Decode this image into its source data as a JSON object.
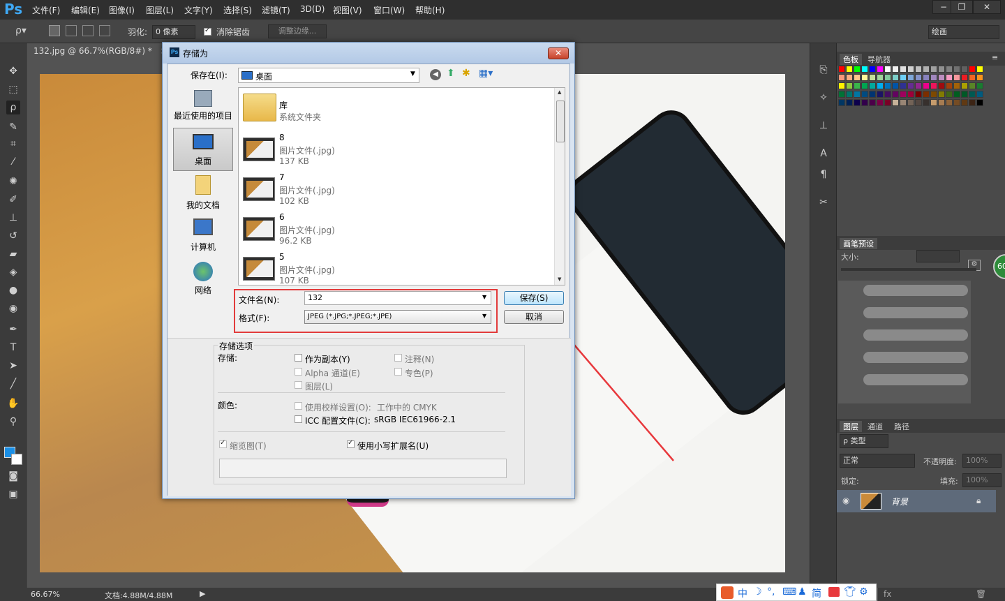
{
  "app": {
    "logo": "Ps"
  },
  "menu": [
    "文件(F)",
    "编辑(E)",
    "图像(I)",
    "图层(L)",
    "文字(Y)",
    "选择(S)",
    "滤镜(T)",
    "3D(D)",
    "视图(V)",
    "窗口(W)",
    "帮助(H)"
  ],
  "options": {
    "feather_label": "羽化:",
    "feather_value": "0 像素",
    "antialias_label": "消除锯齿",
    "refine_edge": "调整边缘...",
    "workspace": "绘画"
  },
  "document": {
    "tab": "132.jpg @ 66.7%(RGB/8#) *",
    "close": "×"
  },
  "status": {
    "zoom": "66.67%",
    "doc_info": "文档:4.88M/4.88M"
  },
  "panels": {
    "color_tab": "色板",
    "navigator_tab": "导航器",
    "brush_preset_tab": "画笔预设",
    "size_label": "大小:",
    "layers_tab": "图层",
    "channels_tab": "通道",
    "paths_tab": "路径",
    "kind_filter": "ρ 类型",
    "blend_mode": "正常",
    "opacity_label": "不透明度:",
    "opacity_value": "100%",
    "lock_label": "锁定:",
    "fill_label": "填充:",
    "fill_value": "100%",
    "layer_name": "背景",
    "brush_size_badge": "60",
    "swatch_colors": [
      "#ff0000",
      "#ffff00",
      "#00ff00",
      "#00ffff",
      "#0000ff",
      "#ff00ff",
      "#ffffff",
      "#f0f0f0",
      "#e0e0e0",
      "#d0d0d0",
      "#c0c0c0",
      "#b0b0b0",
      "#a0a0a0",
      "#909090",
      "#808080",
      "#707070",
      "#606060",
      "#ff0000",
      "#ffff00"
    ]
  },
  "dialog": {
    "title": "存储为",
    "save_in_label": "保存在(I):",
    "save_in_value": "桌面",
    "places": [
      "最近使用的项目",
      "桌面",
      "我的文档",
      "计算机",
      "网络"
    ],
    "files": [
      {
        "name": "库",
        "type": "系统文件夹",
        "size": ""
      },
      {
        "name": "8",
        "type": "图片文件(.jpg)",
        "size": "137 KB"
      },
      {
        "name": "7",
        "type": "图片文件(.jpg)",
        "size": "102 KB"
      },
      {
        "name": "6",
        "type": "图片文件(.jpg)",
        "size": "96.2 KB"
      },
      {
        "name": "5",
        "type": "图片文件(.jpg)",
        "size": "107 KB"
      }
    ],
    "filename_label": "文件名(N):",
    "filename_value": "132",
    "format_label": "格式(F):",
    "format_value": "JPEG (*.JPG;*.JPEG;*.JPE)",
    "save_button": "保存(S)",
    "cancel_button": "取消",
    "options_title": "存储选项",
    "save_group": "存储:",
    "as_copy": "作为副本(Y)",
    "notes": "注释(N)",
    "alpha": "Alpha 通道(E)",
    "spot": "专色(P)",
    "layers": "图层(L)",
    "color_group": "颜色:",
    "proof_setup": "使用校样设置(O):",
    "proof_value": "工作中的 CMYK",
    "icc_profile": "ICC 配置文件(C):",
    "icc_value": "sRGB IEC61966-2.1",
    "thumbnail": "缩览图(T)",
    "lowercase_ext": "使用小写扩展名(U)"
  },
  "taskbar": {
    "items": [
      "中",
      "简"
    ]
  }
}
